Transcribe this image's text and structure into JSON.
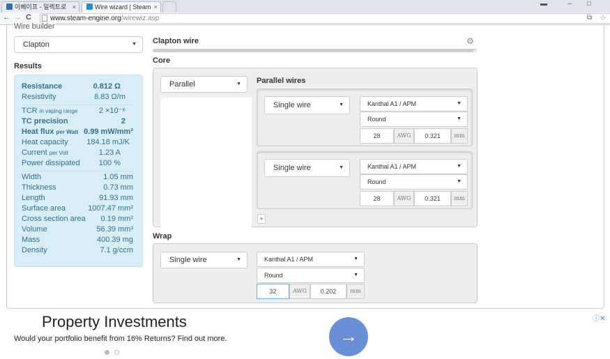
{
  "browser": {
    "tabs": [
      {
        "label": "이베이프 - 일렉트로"
      },
      {
        "label": "Wire wizard | Steam"
      }
    ],
    "url_host": "www.steam-engine.org",
    "url_path": "/wirewiz.asp"
  },
  "page": {
    "legend": "Wire builder",
    "type_select": "Clapton",
    "results_heading": "Results",
    "section_title": "Clapton wire",
    "progress_fraction": 0.99,
    "core_heading": "Core",
    "wrap_heading": "Wrap",
    "core_mode_select": "Parallel",
    "parallel_heading": "Parallel wires",
    "add_button": "+",
    "parallel_wires": [
      {
        "type": "Single wire",
        "material": "Kanthal A1 / APM",
        "shape": "Round",
        "gauge": "28",
        "gauge_unit": "AWG",
        "diameter": "0.321",
        "diameter_unit": "mm"
      },
      {
        "type": "Single wire",
        "material": "Kanthal A1 / APM",
        "shape": "Round",
        "gauge": "28",
        "gauge_unit": "AWG",
        "diameter": "0.321",
        "diameter_unit": "mm"
      }
    ],
    "wrap": {
      "type": "Single wire",
      "material": "Kanthal A1 / APM",
      "shape": "Round",
      "gauge": "32",
      "gauge_unit": "AWG",
      "diameter": "0.202",
      "diameter_unit": "mm"
    }
  },
  "results": {
    "resistance": {
      "label": "Resistance",
      "value": "0.812 Ω"
    },
    "resistivity": {
      "label": "Resistivity",
      "value": "8.83 Ω/m"
    },
    "tcr": {
      "label": "TCR",
      "note": "in vaping range",
      "value": "2 ×10⁻⁶"
    },
    "tc_precision": {
      "label": "TC precision",
      "value": "2"
    },
    "heat_flux": {
      "label": "Heat flux",
      "note": "per Watt",
      "value": "0.99 mW/mm²"
    },
    "heat_capacity": {
      "label": "Heat capacity",
      "value": "184.18 mJ/K"
    },
    "current": {
      "label": "Current",
      "note": "per Volt",
      "value": "1.23 A"
    },
    "power": {
      "label": "Power dissipated",
      "value": "100 %"
    },
    "width": {
      "label": "Width",
      "value": "1.05 mm"
    },
    "thickness": {
      "label": "Thickness",
      "value": "0.73 mm"
    },
    "length": {
      "label": "Length",
      "value": "91.93 mm"
    },
    "surface": {
      "label": "Surface area",
      "value": "1007.47 mm²"
    },
    "cross": {
      "label": "Cross section area",
      "value": "0.19 mm²"
    },
    "volume": {
      "label": "Volume",
      "value": "56.39 mm³"
    },
    "mass": {
      "label": "Mass",
      "value": "400.39 mg"
    },
    "density": {
      "label": "Density",
      "value": "7.1 g/ccm"
    }
  },
  "ad": {
    "title": "Property Investments",
    "text": "Would your portfolio benefit from 16% Returns? Find out more.",
    "button_glyph": "→",
    "choices_glyph": "ⓘ✕"
  },
  "colors": {
    "results_bg": "#d9edf7",
    "results_text": "#31708f",
    "ad_button": "#6b8fd6"
  }
}
